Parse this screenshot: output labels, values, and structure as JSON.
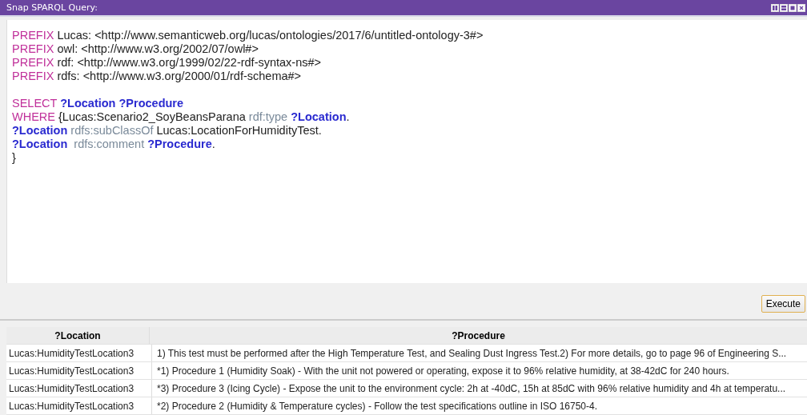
{
  "window": {
    "title": "Snap SPARQL Query:"
  },
  "editor": {
    "blocks": [
      [
        {
          "tokens": [
            {
              "kind": "keyword",
              "text": "PREFIX"
            },
            {
              "kind": "plain",
              "text": " Lucas: <http://www.semanticweb.org/lucas/ontologies/2017/6/untitled-ontology-3#>"
            }
          ]
        },
        {
          "tokens": [
            {
              "kind": "keyword",
              "text": "PREFIX"
            },
            {
              "kind": "plain",
              "text": " owl: <http://www.w3.org/2002/07/owl#>"
            }
          ]
        },
        {
          "tokens": [
            {
              "kind": "keyword",
              "text": "PREFIX"
            },
            {
              "kind": "plain",
              "text": " rdf: <http://www.w3.org/1999/02/22-rdf-syntax-ns#>"
            }
          ]
        },
        {
          "tokens": [
            {
              "kind": "keyword",
              "text": "PREFIX"
            },
            {
              "kind": "plain",
              "text": " rdfs: <http://www.w3.org/2000/01/rdf-schema#>"
            }
          ]
        }
      ],
      [
        {
          "tokens": [
            {
              "kind": "keyword",
              "text": "SELECT "
            },
            {
              "kind": "variable",
              "text": "?Location ?Procedure"
            }
          ]
        },
        {
          "tokens": [
            {
              "kind": "keyword",
              "text": "WHERE"
            },
            {
              "kind": "plain",
              "text": " {Lucas:Scenario2_SoyBeansParana "
            },
            {
              "kind": "predicate",
              "text": "rdf:type "
            },
            {
              "kind": "variable",
              "text": "?Location"
            },
            {
              "kind": "plain",
              "text": "."
            }
          ]
        },
        {
          "tokens": [
            {
              "kind": "variable",
              "text": "?Location"
            },
            {
              "kind": "predicate",
              "text": " rdfs:subClassOf"
            },
            {
              "kind": "plain",
              "text": " Lucas:LocationForHumidityTest."
            }
          ]
        },
        {
          "tokens": [
            {
              "kind": "variable",
              "text": "?Location"
            },
            {
              "kind": "predicate",
              "text": "  rdfs:comment "
            },
            {
              "kind": "variable",
              "text": "?Procedure"
            },
            {
              "kind": "plain",
              "text": "."
            }
          ]
        },
        {
          "tokens": [
            {
              "kind": "plain",
              "text": "}"
            }
          ]
        }
      ]
    ]
  },
  "execute_button": "Execute",
  "table": {
    "columns": [
      "?Location",
      "?Procedure"
    ],
    "rows": [
      [
        "Lucas:HumidityTestLocation3",
        "1) This test must be performed after the High Temperature Test, and Sealing Dust Ingress Test.2) For more details, go to page 96 of Engineering S..."
      ],
      [
        "Lucas:HumidityTestLocation3",
        "*1) Procedure 1 (Humidity Soak) - With the unit not powered or operating, expose it to 96% relative humidity, at 38-42dC for 240 hours."
      ],
      [
        "Lucas:HumidityTestLocation3",
        "*3) Procedure 3 (Icing Cycle) - Expose the unit to the environment cycle: 2h at -40dC, 15h at 85dC with 96% relative humidity and 4h at temperatu..."
      ],
      [
        "Lucas:HumidityTestLocation3",
        "*2) Procedure 2 (Humidity & Temperature cycles) - Follow the test specifications outline in ISO 16750-4."
      ]
    ]
  }
}
